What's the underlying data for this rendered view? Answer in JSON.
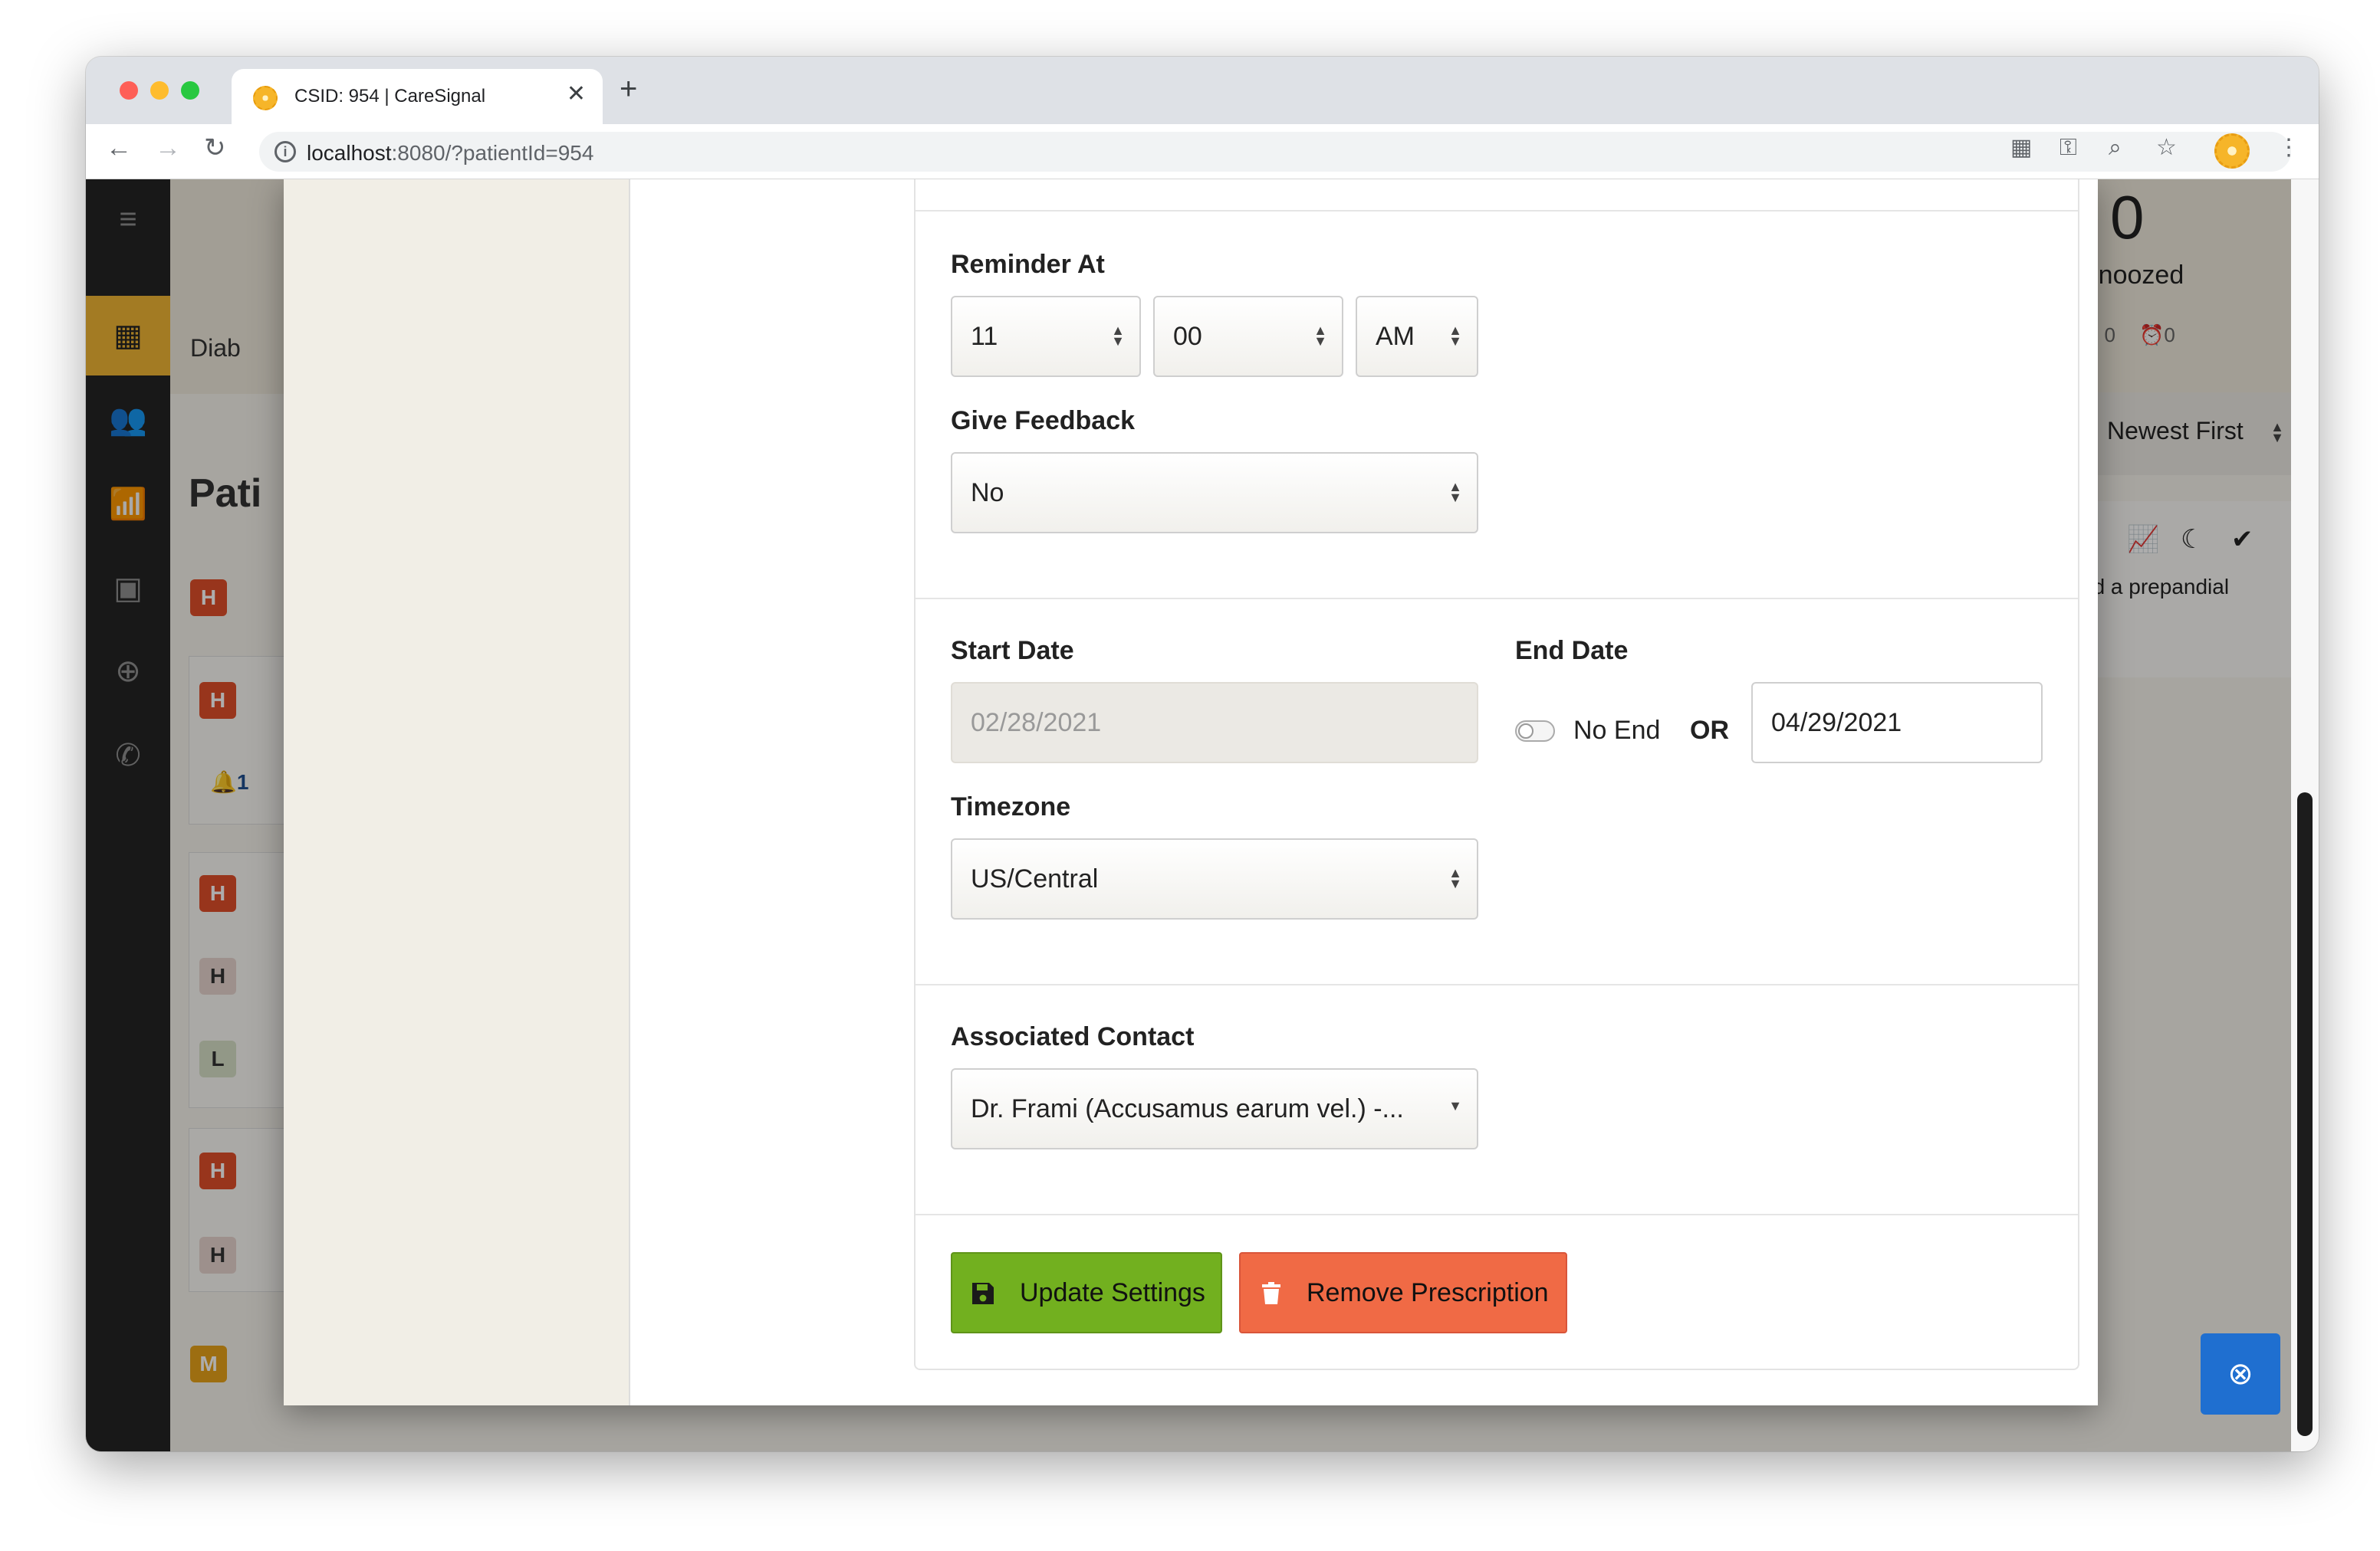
{
  "browser": {
    "tab_title": "CSID: 954 | CareSignal",
    "url_host": "localhost",
    "url_path": ":8080/?patientId=954",
    "tab_close": "✕",
    "new_tab": "+"
  },
  "background": {
    "group_label": "Diab",
    "page_title": "Pati",
    "letter_h": "H",
    "letter_m": "M",
    "letter_l": "L",
    "alert_count": "1",
    "stats": {
      "count": "0",
      "label": "Snoozed",
      "moon_count": "0",
      "alarm_count": "0"
    },
    "sort": {
      "label": "Newest First"
    },
    "activity_snippet": "ed a prepandial"
  },
  "form": {
    "reminder_label": "Reminder At",
    "hour": "11",
    "minute": "00",
    "ampm": "AM",
    "feedback_label": "Give Feedback",
    "feedback_value": "No",
    "start_date_label": "Start Date",
    "start_date_value": "02/28/2021",
    "end_date_label": "End Date",
    "no_end_label": "No End",
    "or_label": "OR",
    "end_date_value": "04/29/2021",
    "timezone_label": "Timezone",
    "timezone_value": "US/Central",
    "contact_label": "Associated Contact",
    "contact_value": "Dr. Frami (Accusamus earum vel.) -..."
  },
  "buttons": {
    "update_label": "Update Settings",
    "remove_label": "Remove Prescription"
  },
  "colors": {
    "accent": "#f0b634",
    "update_button": "#72b01f",
    "remove_button": "#f06a45",
    "sidebar": "#242424",
    "help_button": "#1f6fd0"
  }
}
